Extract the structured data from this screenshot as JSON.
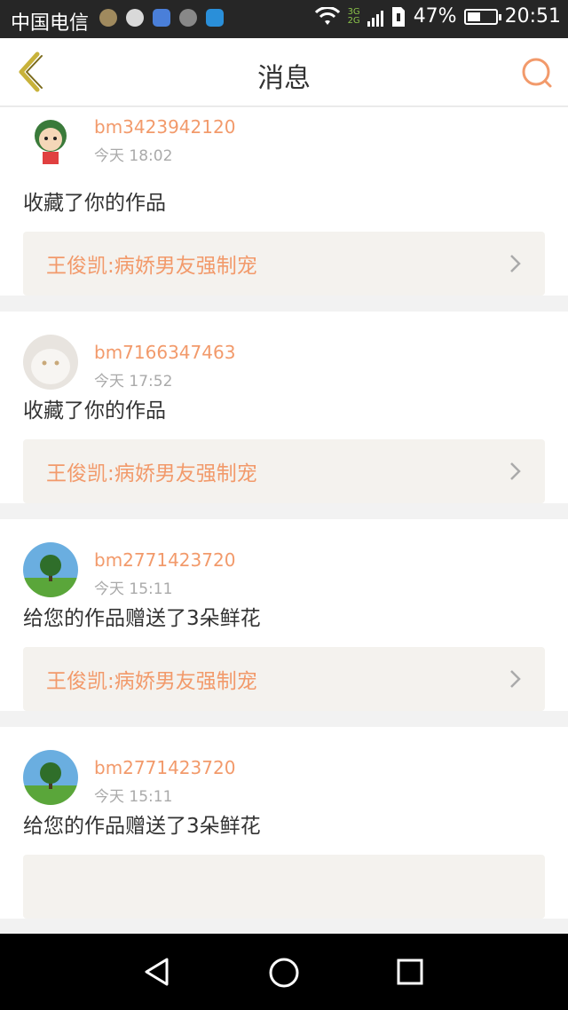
{
  "status_bar": {
    "carrier": "中国电信",
    "network_3g": "3G",
    "network_2g": "2G",
    "battery_percent": "47%",
    "time": "20:51",
    "battery_level": 0.47
  },
  "header": {
    "title": "消息",
    "back_icon": "back-chevron-icon",
    "search_icon": "search-icon"
  },
  "messages": [
    {
      "username": "bm3423942120",
      "time": "今天 18:02",
      "action": "收藏了你的作品",
      "work_title": "王俊凯:病娇男友强制宠",
      "avatar": "cartoon-girl-avatar"
    },
    {
      "username": "bm7166347463",
      "time": "今天 17:52",
      "action": "收藏了你的作品",
      "work_title": "王俊凯:病娇男友强制宠",
      "avatar": "white-cat-avatar"
    },
    {
      "username": "bm2771423720",
      "time": "今天 15:11",
      "action": "给您的作品赠送了3朵鲜花",
      "work_title": "王俊凯:病娇男友强制宠",
      "avatar": "tree-landscape-avatar"
    },
    {
      "username": "bm2771423720",
      "time": "今天 15:11",
      "action": "给您的作品赠送了3朵鲜花",
      "work_title": "",
      "avatar": "tree-landscape-avatar"
    }
  ],
  "colors": {
    "accent": "#f29a6b",
    "back_arrow": "#c8b23a"
  }
}
